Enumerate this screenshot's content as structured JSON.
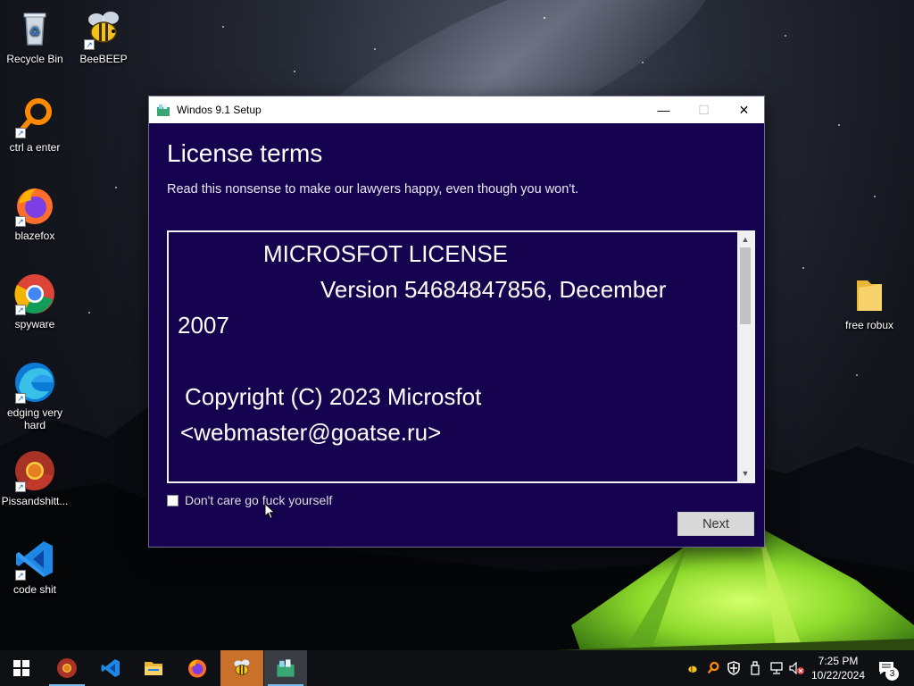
{
  "desktop": {
    "icons": [
      {
        "label": "Recycle Bin",
        "icon": "recycle-bin-icon"
      },
      {
        "label": "BeeBEEP",
        "icon": "bee-icon"
      },
      {
        "label": "ctrl a enter",
        "icon": "magnifier-icon"
      },
      {
        "label": "blazefox",
        "icon": "firefox-icon"
      },
      {
        "label": "spyware",
        "icon": "chrome-icon"
      },
      {
        "label": "edging very hard",
        "icon": "edge-icon"
      },
      {
        "label": "Pissandshitt...",
        "icon": "chromium-icon"
      },
      {
        "label": "code shit",
        "icon": "vscode-icon"
      },
      {
        "label": "free robux",
        "icon": "folder-icon"
      }
    ]
  },
  "window": {
    "title": "Windos 9.1 Setup",
    "controls": {
      "minimize": "—",
      "maximize": "☐",
      "close": "✕"
    },
    "heading": "License terms",
    "subheading": "Read this nonsense to make our lawyers happy, even though you won't.",
    "license": {
      "line1": "MICROSFOT LICENSE",
      "line2": "Version 54684847856, December",
      "line3": "2007",
      "line4": "Copyright (C) 2023 Microsfot",
      "line5": "<webmaster@goatse.ru>"
    },
    "scrollbar": {
      "up": "▲",
      "down": "▼"
    },
    "checkbox_label": "Don't care go fuck yourself",
    "checkbox_checked": false,
    "next_label": "Next"
  },
  "taskbar": {
    "pinned": [
      "start-icon",
      "chromium-icon",
      "vscode-icon",
      "file-explorer-icon",
      "firefox-icon",
      "bee-icon",
      "setup-icon"
    ],
    "time": "7:25 PM",
    "date": "10/22/2024",
    "notification_count": "3"
  },
  "colors": {
    "window_bg": "#16034f",
    "taskbar_bg": "#0f1014",
    "accent": "#76b9ed"
  }
}
